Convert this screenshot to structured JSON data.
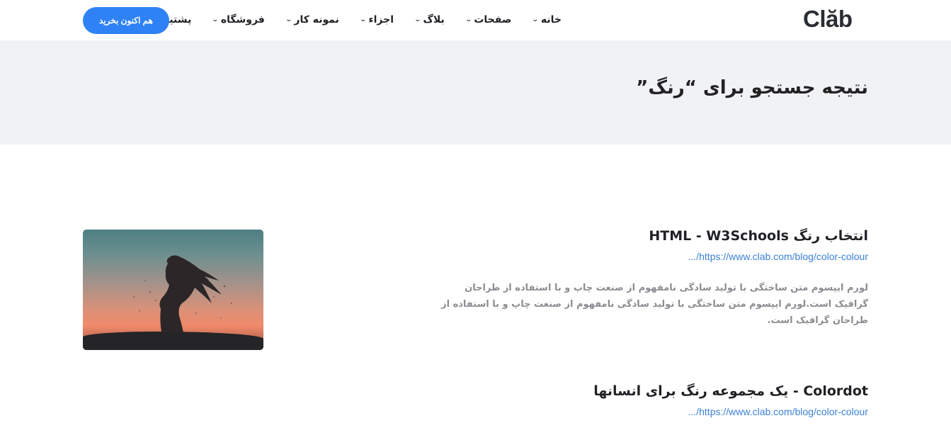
{
  "header": {
    "logo": "Clăb",
    "nav": [
      {
        "label": "خانه"
      },
      {
        "label": "صفحات"
      },
      {
        "label": "بلاگ"
      },
      {
        "label": "اجزاء"
      },
      {
        "label": "نمونه کار"
      },
      {
        "label": "فروشگاه"
      },
      {
        "label": "پشتیبانی"
      }
    ],
    "buy_button": "هم اکنون بخرید"
  },
  "banner": {
    "title": "نتیجه جستجو برای “رنگ”"
  },
  "results": [
    {
      "title": "انتخاب رنگ HTML - W3Schools",
      "url": "https://www.clab.com/blog/color-colour/...",
      "description": "لورم ایپسوم متن ساختگی با تولید سادگی نامفهوم از صنعت چاپ و با استفاده از طراحان گرافیک است.لورم ایپسوم متن ساختگی با تولید سادگی نامفهوم از صنعت چاپ و با استفاده از طراحان گرافیک است."
    },
    {
      "title": "Colordot - یک مجموعه رنگ برای انسانها",
      "url": "https://www.clab.com/blog/color-colour/..."
    }
  ]
}
